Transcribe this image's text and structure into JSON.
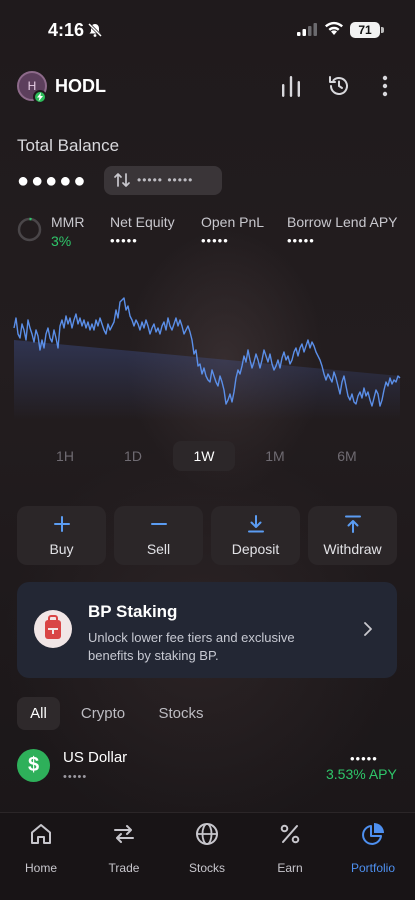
{
  "status_bar": {
    "time": "4:16",
    "battery": "71"
  },
  "header": {
    "avatar_letter": "H",
    "app_name": "HODL"
  },
  "balance": {
    "label": "Total Balance",
    "hidden_value": "●●●●●",
    "hidden_converted": "••••• •••••"
  },
  "metrics": [
    {
      "label": "MMR",
      "value": "3%"
    },
    {
      "label": "Net Equity",
      "value": "•••••"
    },
    {
      "label": "Open PnL",
      "value": "•••••"
    },
    {
      "label": "Borrow Lend APY",
      "value": "•••••"
    }
  ],
  "timeframes": [
    "1H",
    "1D",
    "1W",
    "1M",
    "6M"
  ],
  "selected_timeframe": "1W",
  "actions": [
    "Buy",
    "Sell",
    "Deposit",
    "Withdraw"
  ],
  "staking": {
    "title": "BP Staking",
    "description": "Unlock lower fee tiers and exclusive benefits by staking BP."
  },
  "asset_tabs": [
    "All",
    "Crypto",
    "Stocks"
  ],
  "assets": [
    {
      "name": "US Dollar",
      "symbol": "$",
      "sub": "•••••",
      "amount": "•••••",
      "apy": "3.53% APY"
    }
  ],
  "bottom_nav": [
    "Home",
    "Trade",
    "Stocks",
    "Earn",
    "Portfolio"
  ],
  "active_nav": "Portfolio",
  "colors": {
    "accent_blue": "#4e90f0",
    "positive_green": "#2fc66a",
    "chart_line": "#5b8fe8"
  }
}
